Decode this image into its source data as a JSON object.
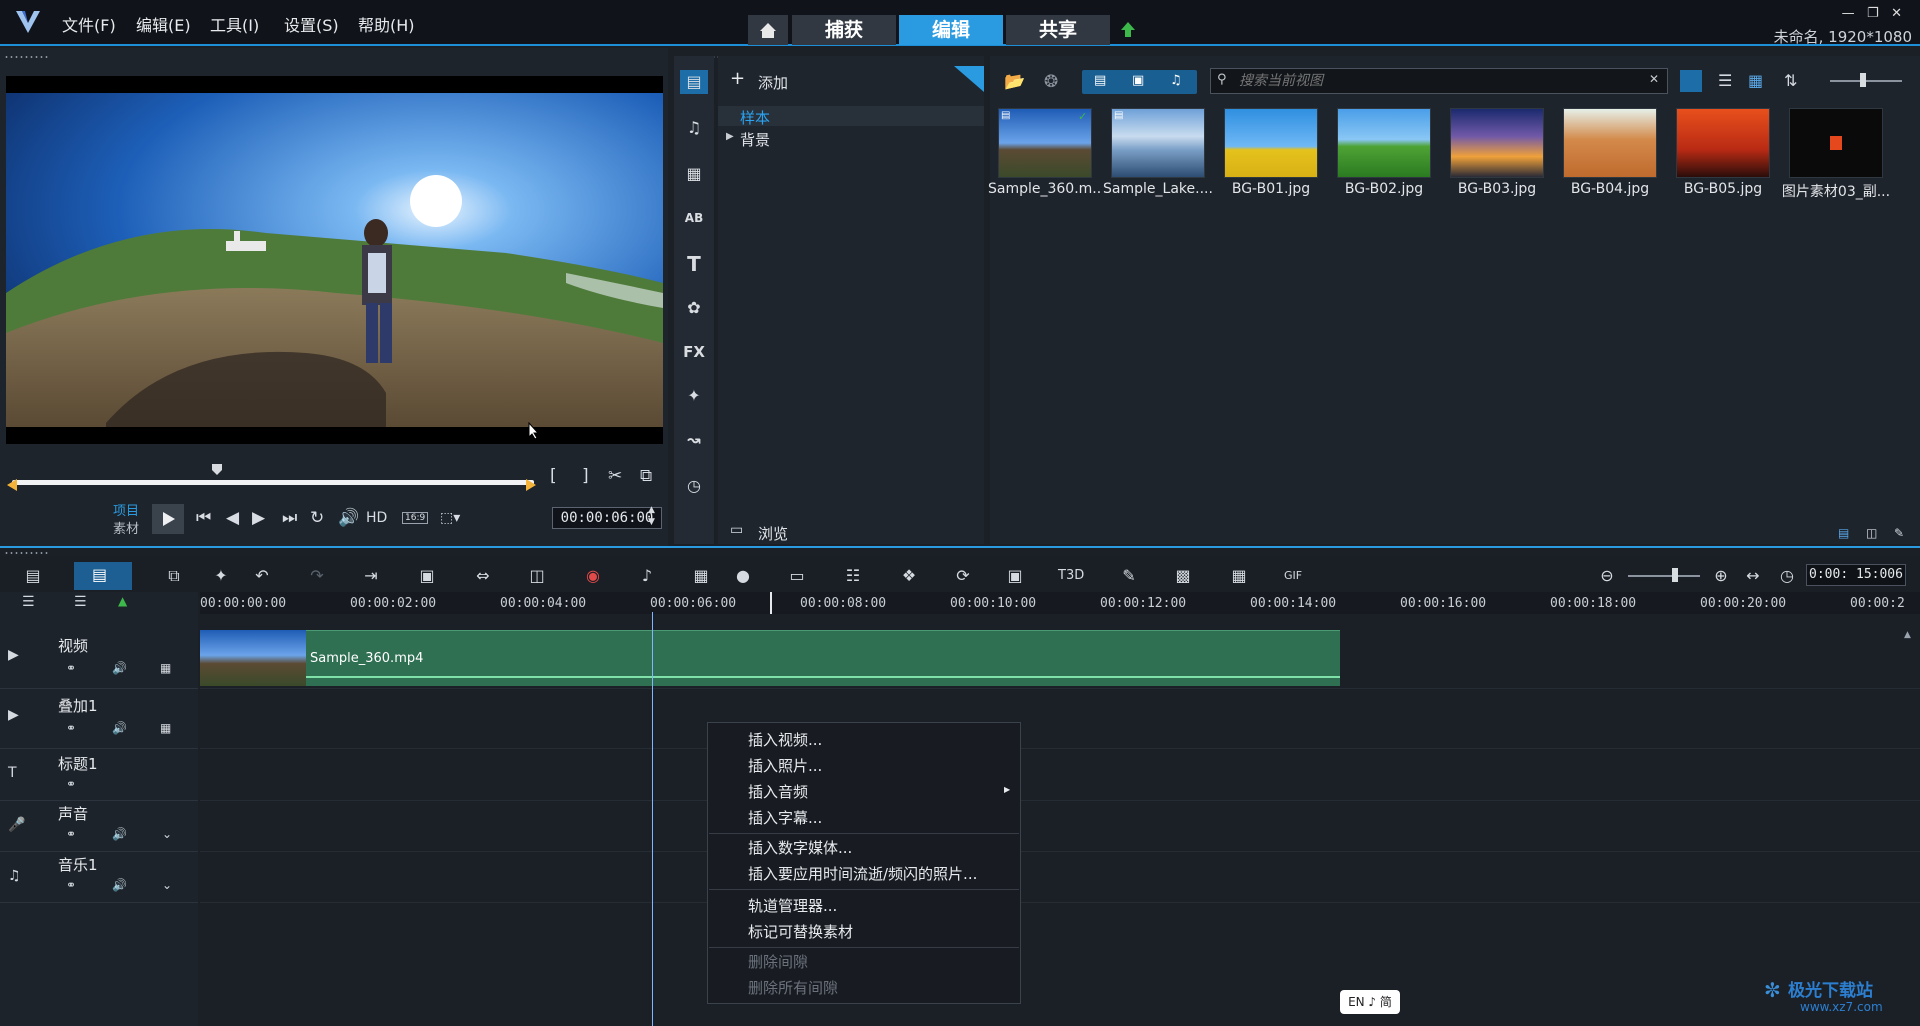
{
  "menubar": {
    "items": [
      "文件(F)",
      "编辑(E)",
      "工具(I)",
      "设置(S)",
      "帮助(H)"
    ],
    "tabs": [
      "捕获",
      "编辑",
      "共享"
    ],
    "active_tab": "编辑",
    "project_info": "未命名, 1920*1080"
  },
  "player": {
    "mode_project": "项目",
    "mode_clip": "素材",
    "hd_label": "HD",
    "aspect_label": "16:9",
    "timecode": "00:00:06:00"
  },
  "library": {
    "add_label": "添加",
    "tree": [
      {
        "label": "样本",
        "selected": true
      },
      {
        "label": "背景",
        "selected": false
      }
    ],
    "browse_label": "浏览"
  },
  "media": {
    "search_placeholder": "搜索当前视图",
    "items": [
      {
        "name": "Sample_360.m...",
        "kind": "video",
        "checked": true
      },
      {
        "name": "Sample_Lake....",
        "kind": "video",
        "checked": false
      },
      {
        "name": "BG-B01.jpg",
        "kind": "image",
        "checked": false
      },
      {
        "name": "BG-B02.jpg",
        "kind": "image",
        "checked": false
      },
      {
        "name": "BG-B03.jpg",
        "kind": "image",
        "checked": false
      },
      {
        "name": "BG-B04.jpg",
        "kind": "image",
        "checked": false
      },
      {
        "name": "BG-B05.jpg",
        "kind": "image",
        "checked": false
      },
      {
        "name": "图片素材03_副...",
        "kind": "image",
        "checked": false
      }
    ]
  },
  "timeline": {
    "duration": "0:00: 15:006",
    "ruler_ticks": [
      "00:00:00:00",
      "00:00:02:00",
      "00:00:04:00",
      "00:00:06:00",
      "00:00:08:00",
      "00:00:10:00",
      "00:00:12:00",
      "00:00:14:00",
      "00:00:16:00",
      "00:00:18:00",
      "00:00:20:00",
      "00:00:2"
    ],
    "tracks": [
      {
        "name": "视频"
      },
      {
        "name": "叠加1"
      },
      {
        "name": "标题1"
      },
      {
        "name": "声音"
      },
      {
        "name": "音乐1"
      }
    ],
    "clip_name": "Sample_360.mp4"
  },
  "context_menu": {
    "items": [
      {
        "label": "插入视频...",
        "enabled": true,
        "submenu": false
      },
      {
        "label": "插入照片...",
        "enabled": true,
        "submenu": false
      },
      {
        "label": "插入音频",
        "enabled": true,
        "submenu": true
      },
      {
        "label": "插入字幕...",
        "enabled": true,
        "submenu": false
      },
      {
        "label": "插入数字媒体...",
        "enabled": true,
        "submenu": false
      },
      {
        "label": "插入要应用时间流逝/频闪的照片...",
        "enabled": true,
        "submenu": false
      },
      {
        "label": "轨道管理器...",
        "enabled": true,
        "submenu": false
      },
      {
        "label": "标记可替换素材",
        "enabled": true,
        "submenu": false
      },
      {
        "label": "删除间隙",
        "enabled": false,
        "submenu": false
      },
      {
        "label": "删除所有间隙",
        "enabled": false,
        "submenu": false
      }
    ]
  },
  "ime": {
    "label": "EN ♪ 简"
  },
  "watermark": {
    "text": "极光下载站",
    "url_text": "www.xz7.com"
  },
  "colors": {
    "accent": "#2a9be0",
    "clip": "#2f6f52",
    "playhead": "#7fb6ff"
  }
}
